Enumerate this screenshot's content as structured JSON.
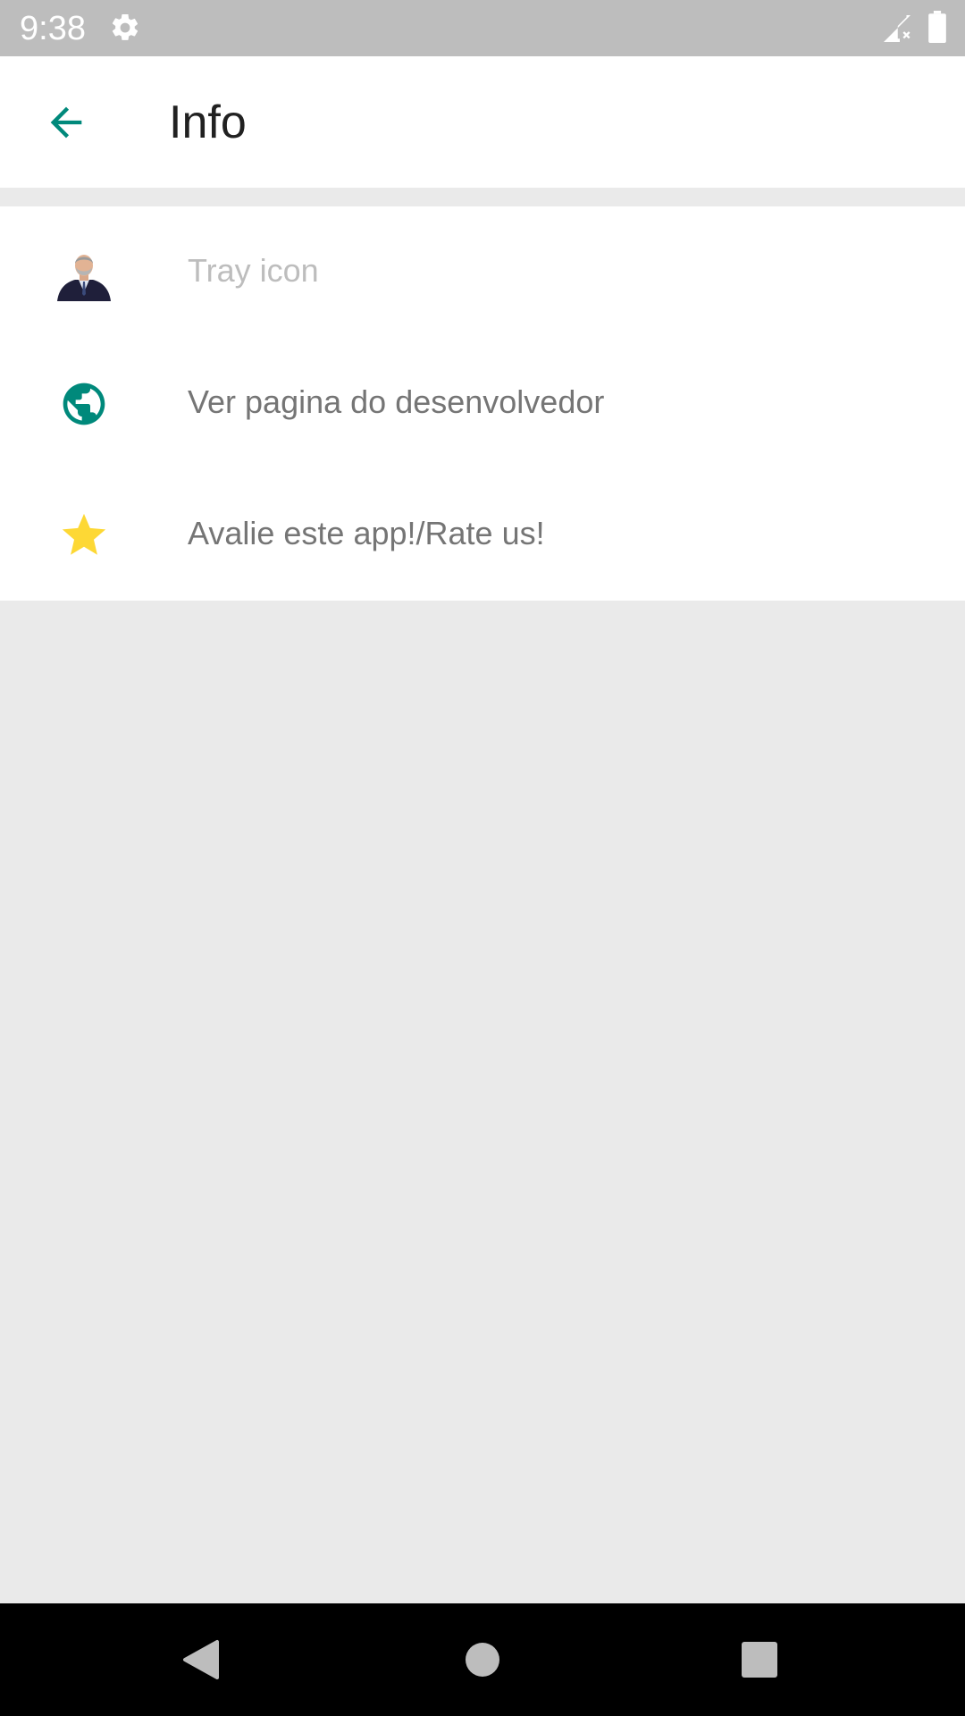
{
  "status_bar": {
    "time": "9:38",
    "icons": [
      "gear-icon",
      "signal-off-icon",
      "battery-icon"
    ]
  },
  "app_bar": {
    "title": "Info",
    "back_icon": "arrow-back-icon"
  },
  "list": {
    "items": [
      {
        "label": "Tray icon",
        "icon": "avatar-photo"
      },
      {
        "label": "Ver pagina do desenvolvedor",
        "icon": "globe-icon"
      },
      {
        "label": "Avalie este app!/Rate us!",
        "icon": "star-icon"
      }
    ]
  },
  "nav_bar": {
    "icons": [
      "back-triangle-icon",
      "home-circle-icon",
      "recents-square-icon"
    ]
  },
  "colors": {
    "accent": "#00897b",
    "star": "#fdd835",
    "status_bar": "#bdbdbd",
    "background": "#eaeaea"
  }
}
